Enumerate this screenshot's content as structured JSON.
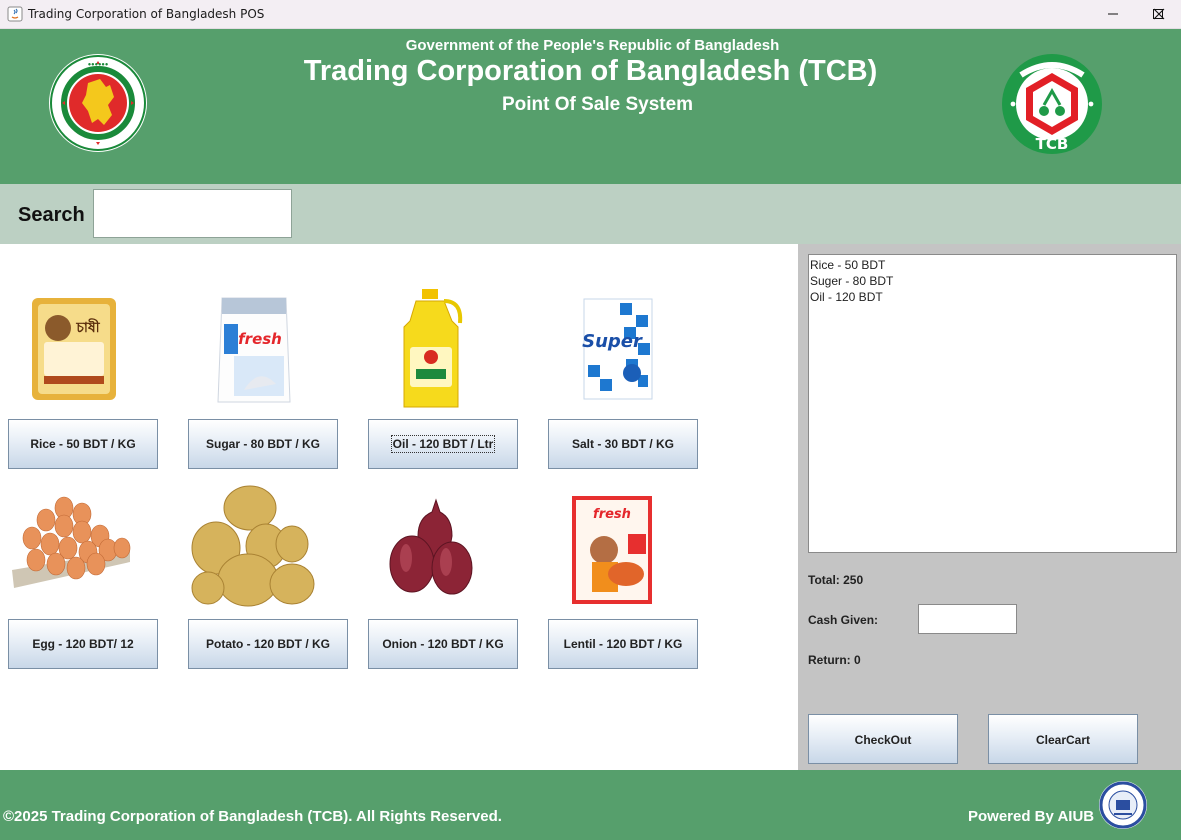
{
  "window": {
    "title": "Trading Corporation of Bangladesh POS"
  },
  "header": {
    "government": "Government of the People's Republic of Bangladesh",
    "title": "Trading Corporation of Bangladesh (TCB)",
    "subtitle": "Point Of Sale System",
    "left_logo": "bangladesh-government-seal",
    "right_logo": "tcb-logo",
    "right_logo_text": "TCB"
  },
  "search": {
    "label": "Search",
    "value": ""
  },
  "products": [
    {
      "label": "Rice - 50 BDT / KG",
      "image": "rice-bag"
    },
    {
      "label": "Sugar - 80 BDT / KG",
      "image": "sugar-bag"
    },
    {
      "label": "Oil - 120 BDT / Ltr",
      "image": "oil-bottle"
    },
    {
      "label": "Salt - 30 BDT / KG",
      "image": "salt-pack"
    },
    {
      "label": "Egg - 120 BDT/ 12",
      "image": "egg-tray"
    },
    {
      "label": "Potato - 120 BDT / KG",
      "image": "potatoes"
    },
    {
      "label": "Onion - 120 BDT / KG",
      "image": "onions"
    },
    {
      "label": "Lentil - 120 BDT / KG",
      "image": "lentil-pack"
    }
  ],
  "cart": {
    "items": [
      "Rice - 50 BDT",
      "Suger - 80 BDT",
      "Oil - 120 BDT"
    ],
    "total_label": "Total: 250",
    "cash_label": "Cash Given:",
    "cash_value": "",
    "return_label": "Return: 0",
    "checkout_label": "CheckOut",
    "clear_label": "ClearCart"
  },
  "footer": {
    "copyright": "©2025 Trading Corporation of Bangladesh (TCB). All Rights Reserved.",
    "powered": "Powered By AIUB",
    "badge": "aiub-seal"
  },
  "colors": {
    "header_green": "#569f6c",
    "search_bar": "#bcd0c3",
    "cart_panel": "#c4c4c4"
  }
}
